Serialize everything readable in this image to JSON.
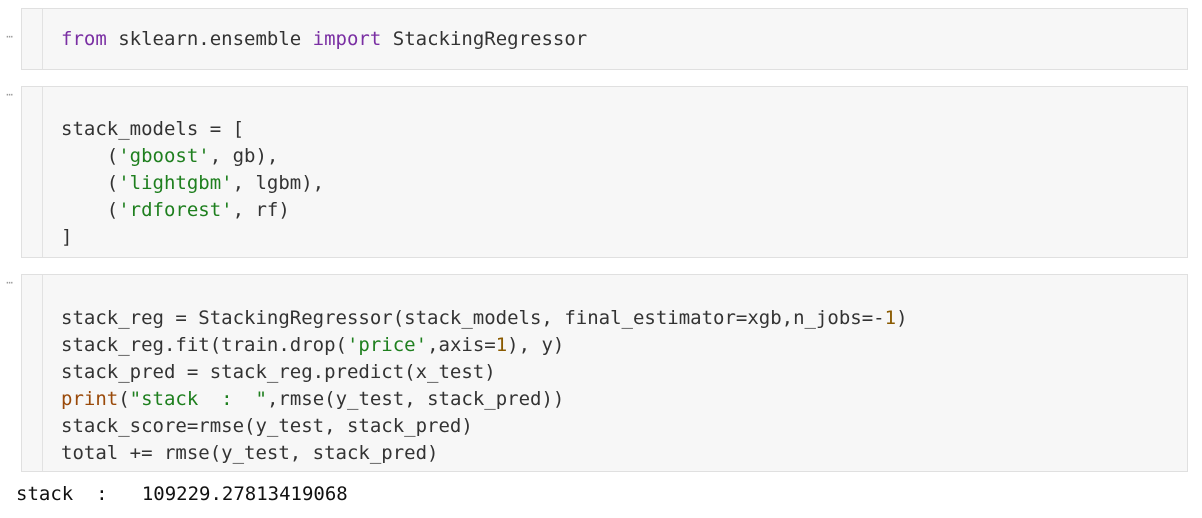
{
  "cells": [
    {
      "lines": [
        [
          {
            "t": "from",
            "c": "kw"
          },
          {
            "t": " sklearn.ensemble "
          },
          {
            "t": "import",
            "c": "kw"
          },
          {
            "t": " StackingRegressor"
          }
        ]
      ]
    },
    {
      "lines": [
        [
          {
            "t": ""
          }
        ],
        [
          {
            "t": "stack_models = ["
          }
        ],
        [
          {
            "t": "    ("
          },
          {
            "t": "'gboost'",
            "c": "str"
          },
          {
            "t": ", gb),"
          }
        ],
        [
          {
            "t": "    ("
          },
          {
            "t": "'lightgbm'",
            "c": "str"
          },
          {
            "t": ", lgbm),"
          }
        ],
        [
          {
            "t": "    ("
          },
          {
            "t": "'rdforest'",
            "c": "str"
          },
          {
            "t": ", rf)"
          }
        ],
        [
          {
            "t": "]"
          }
        ]
      ]
    },
    {
      "lines": [
        [
          {
            "t": ""
          }
        ],
        [
          {
            "t": "stack_reg = StackingRegressor(stack_models, final_estimator=xgb,n_jobs=-"
          },
          {
            "t": "1",
            "c": "num"
          },
          {
            "t": ")"
          }
        ],
        [
          {
            "t": "stack_reg.fit(train.drop("
          },
          {
            "t": "'price'",
            "c": "str"
          },
          {
            "t": ",axis="
          },
          {
            "t": "1",
            "c": "num"
          },
          {
            "t": "), y)"
          }
        ],
        [
          {
            "t": "stack_pred = stack_reg.predict(x_test)"
          }
        ],
        [
          {
            "t": "print",
            "c": "builtin"
          },
          {
            "t": "("
          },
          {
            "t": "\"stack  :  \"",
            "c": "str"
          },
          {
            "t": ",rmse(y_test, stack_pred))"
          }
        ],
        [
          {
            "t": "stack_score=rmse(y_test, stack_pred)"
          }
        ],
        [
          {
            "t": "total += rmse(y_test, stack_pred)"
          }
        ]
      ]
    }
  ],
  "output": {
    "text": "stack  :   109229.27813419068"
  },
  "collapser_glyph": "⋯"
}
